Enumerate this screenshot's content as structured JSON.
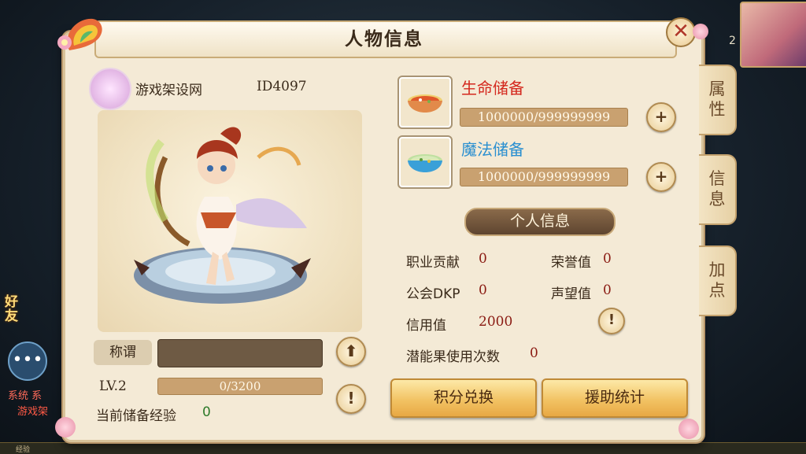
{
  "window": {
    "title": "人物信息"
  },
  "tabs": [
    {
      "label_top": "属",
      "label_bottom": "性"
    },
    {
      "label_top": "信",
      "label_bottom": "息"
    },
    {
      "label_top": "加",
      "label_bottom": "点"
    }
  ],
  "profile": {
    "name": "游戏架设网",
    "id": "ID4097",
    "title_label": "称谓",
    "level": "LV.2",
    "exp_progress": "0/3200",
    "exp_fraction": 0,
    "stored_exp_label": "当前储备经验",
    "stored_exp_value": "0"
  },
  "reserves": {
    "hp": {
      "label": "生命储备",
      "value": "1000000/999999999",
      "color": "#d4281e"
    },
    "mp": {
      "label": "魔法储备",
      "value": "1000000/999999999",
      "color": "#2a8fd0"
    }
  },
  "personal_info": {
    "header": "个人信息",
    "rows": [
      {
        "label": "职业贡献",
        "value": "0"
      },
      {
        "label": "荣誉值",
        "value": "0"
      },
      {
        "label": "公会DKP",
        "value": "0"
      },
      {
        "label": "声望值",
        "value": "0"
      },
      {
        "label": "信用值",
        "value": "2000"
      },
      {
        "label": "潜能果使用次数",
        "value": "0"
      }
    ]
  },
  "buttons": {
    "points_exchange": "积分兑换",
    "assist_stats": "援助统计",
    "plus": "+",
    "info": "!",
    "upload": "⬆",
    "close": "✕"
  },
  "hud": {
    "friend": "好友",
    "chat_icon": "speech-bubble-icon",
    "level_digit": "2",
    "sys_tag": "系统",
    "sys_text": "游戏架",
    "sys_extra": "系",
    "bottom_label": "经验"
  }
}
